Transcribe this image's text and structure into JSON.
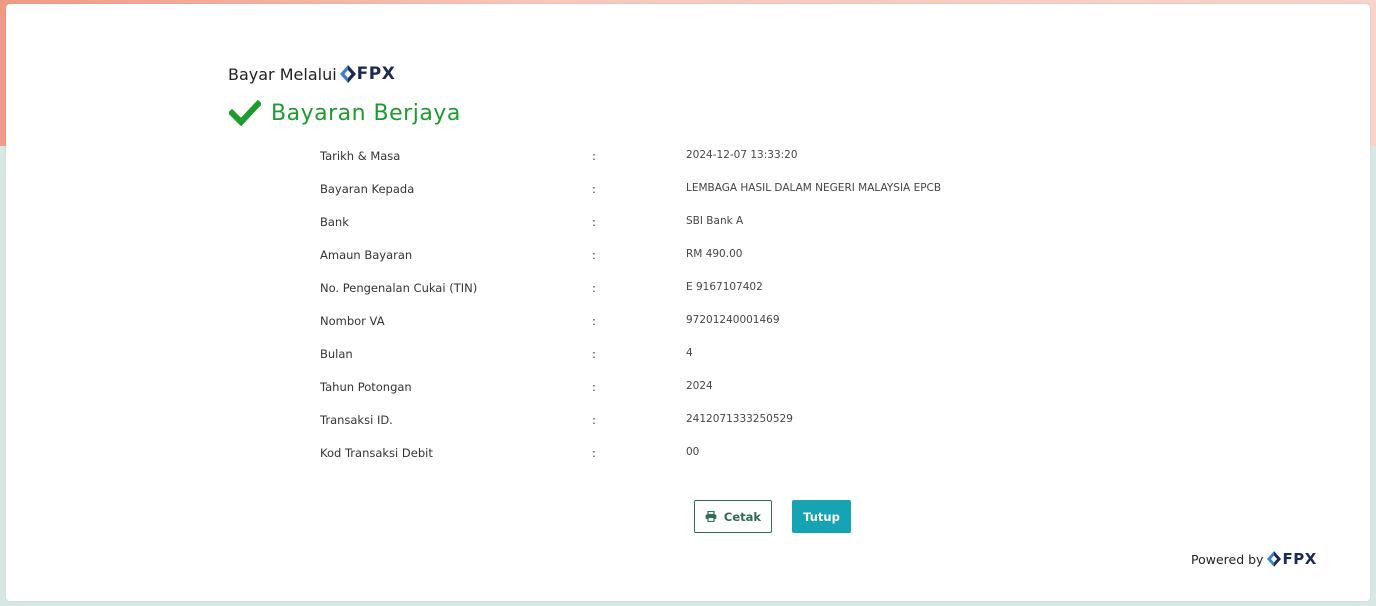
{
  "header": {
    "pay_via_label": "Bayar Melalui",
    "brand": "FPX"
  },
  "status": {
    "title": "Bayaran Berjaya",
    "icon": "checkmark-icon",
    "color": "#1f9a2e"
  },
  "details": [
    {
      "label": "Tarikh & Masa",
      "colon": ":",
      "value": "2024-12-07 13:33:20"
    },
    {
      "label": "Bayaran Kepada",
      "colon": ":",
      "value": "LEMBAGA HASIL DALAM NEGERI MALAYSIA EPCB"
    },
    {
      "label": "Bank",
      "colon": ":",
      "value": "SBI Bank A"
    },
    {
      "label": "Amaun Bayaran",
      "colon": ":",
      "value": "RM 490.00"
    },
    {
      "label": "No. Pengenalan Cukai (TIN)",
      "colon": ":",
      "value": "E 9167107402"
    },
    {
      "label": "Nombor VA",
      "colon": ":",
      "value": "97201240001469"
    },
    {
      "label": "Bulan",
      "colon": ":",
      "value": "4"
    },
    {
      "label": "Tahun Potongan",
      "colon": ":",
      "value": "2024"
    },
    {
      "label": "Transaksi ID.",
      "colon": ":",
      "value": "2412071333250529"
    },
    {
      "label": "Kod Transaksi Debit",
      "colon": ":",
      "value": "00"
    }
  ],
  "buttons": {
    "print_label": "Cetak",
    "close_label": "Tutup"
  },
  "footer": {
    "powered_by_label": "Powered by",
    "brand": "FPX"
  },
  "colors": {
    "accent": "#16a4b5",
    "success": "#1f9a2e",
    "brand_navy": "#1c2a52"
  }
}
